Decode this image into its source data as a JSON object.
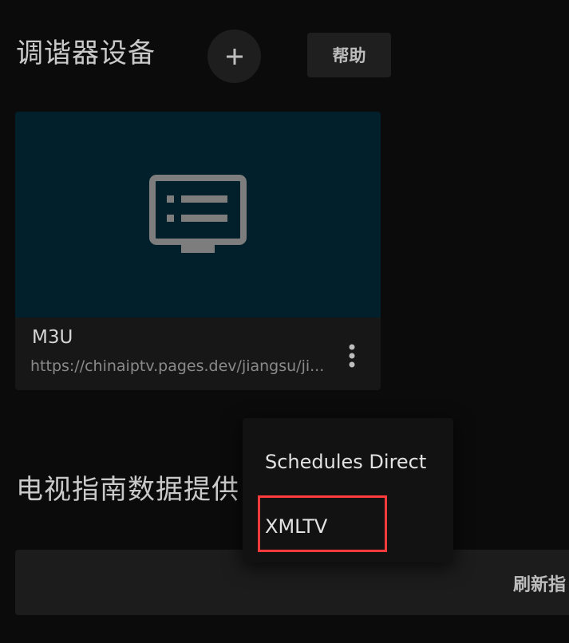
{
  "tuners": {
    "title": "调谐器设备",
    "add_icon": "plus-icon",
    "help_label": "帮助"
  },
  "device": {
    "icon": "tv-list-icon",
    "name": "M3U",
    "url": "https://chinaiptv.pages.dev/jiangsu/ji...",
    "menu_icon": "more-vert-icon"
  },
  "guide": {
    "title": "电视指南数据提供",
    "refresh_label": "刷新指"
  },
  "menu": {
    "items": [
      {
        "label": "Schedules Direct"
      },
      {
        "label": "XMLTV"
      }
    ]
  },
  "colors": {
    "background": "#0b0b0b",
    "card_image": "#01202b",
    "highlight": "#ff3b3b"
  }
}
